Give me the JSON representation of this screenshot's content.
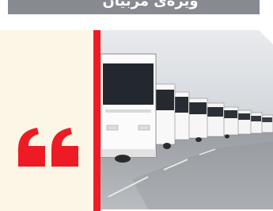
{
  "banner": {
    "text": "ویژه‌ی مربیان"
  },
  "quote": {
    "icon": "quote-mark-icon",
    "color": "#ed1c24"
  },
  "colors": {
    "banner_bg": "#878a90",
    "panel_bg": "#fbf6e5",
    "accent": "#ed1c24"
  }
}
